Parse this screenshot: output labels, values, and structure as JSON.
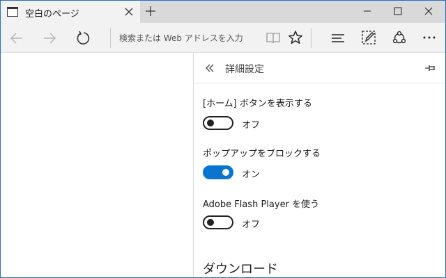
{
  "tab": {
    "title": "空白のページ"
  },
  "address_bar": {
    "placeholder": "検索または Web アドレスを入力"
  },
  "panel": {
    "title": "詳細設定",
    "settings": [
      {
        "label": "[ホーム] ボタンを表示する",
        "state": "オフ",
        "enabled": false
      },
      {
        "label": "ポップアップをブロックする",
        "state": "オン",
        "enabled": true
      },
      {
        "label": "Adobe Flash Player を使う",
        "state": "オフ",
        "enabled": false
      }
    ],
    "section_heading": "ダウンロード"
  },
  "colors": {
    "accent": "#0a74d1",
    "titlebar": "#d9d9d9",
    "navbar": "#f2f2f2"
  }
}
